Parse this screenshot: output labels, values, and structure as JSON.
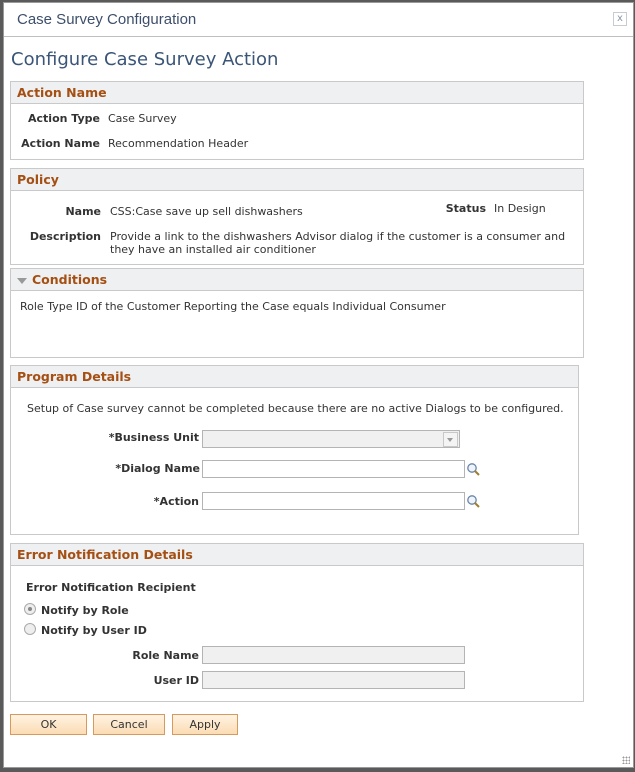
{
  "window": {
    "title": "Case Survey Configuration",
    "close_label": "x"
  },
  "page_title": "Configure Case Survey Action",
  "action_name": {
    "header": "Action Name",
    "action_type_label": "Action Type",
    "action_type_value": "Case Survey",
    "action_name_label": "Action Name",
    "action_name_value": "Recommendation Header"
  },
  "policy": {
    "header": "Policy",
    "name_label": "Name",
    "name_value": "CSS:Case save up sell dishwashers",
    "status_label": "Status",
    "status_value": "In Design",
    "description_label": "Description",
    "description_value": "Provide a link to the dishwashers Advisor dialog if the customer is a consumer and they have an installed air conditioner"
  },
  "conditions": {
    "header": "Conditions",
    "text": "Role Type ID of the Customer Reporting the Case equals Individual Consumer"
  },
  "program_details": {
    "header": "Program Details",
    "message": "Setup of Case survey cannot be completed because there are no active Dialogs to be configured.",
    "business_unit_label": "*Business Unit",
    "business_unit_value": "",
    "dialog_name_label": "*Dialog Name",
    "dialog_name_value": "",
    "action_label": "*Action",
    "action_value": ""
  },
  "error_notification": {
    "header": "Error Notification Details",
    "recipient_label": "Error Notification Recipient",
    "notify_by_role_label": "Notify by Role",
    "notify_by_role_selected": true,
    "notify_by_user_label": "Notify by User ID",
    "notify_by_user_selected": false,
    "role_name_label": "Role Name",
    "role_name_value": "",
    "user_id_label": "User ID",
    "user_id_value": ""
  },
  "buttons": {
    "ok": "OK",
    "cancel": "Cancel",
    "apply": "Apply"
  },
  "colors": {
    "section_header": "#a54f13",
    "page_title": "#3a5578",
    "button_border": "#d79a5e"
  }
}
